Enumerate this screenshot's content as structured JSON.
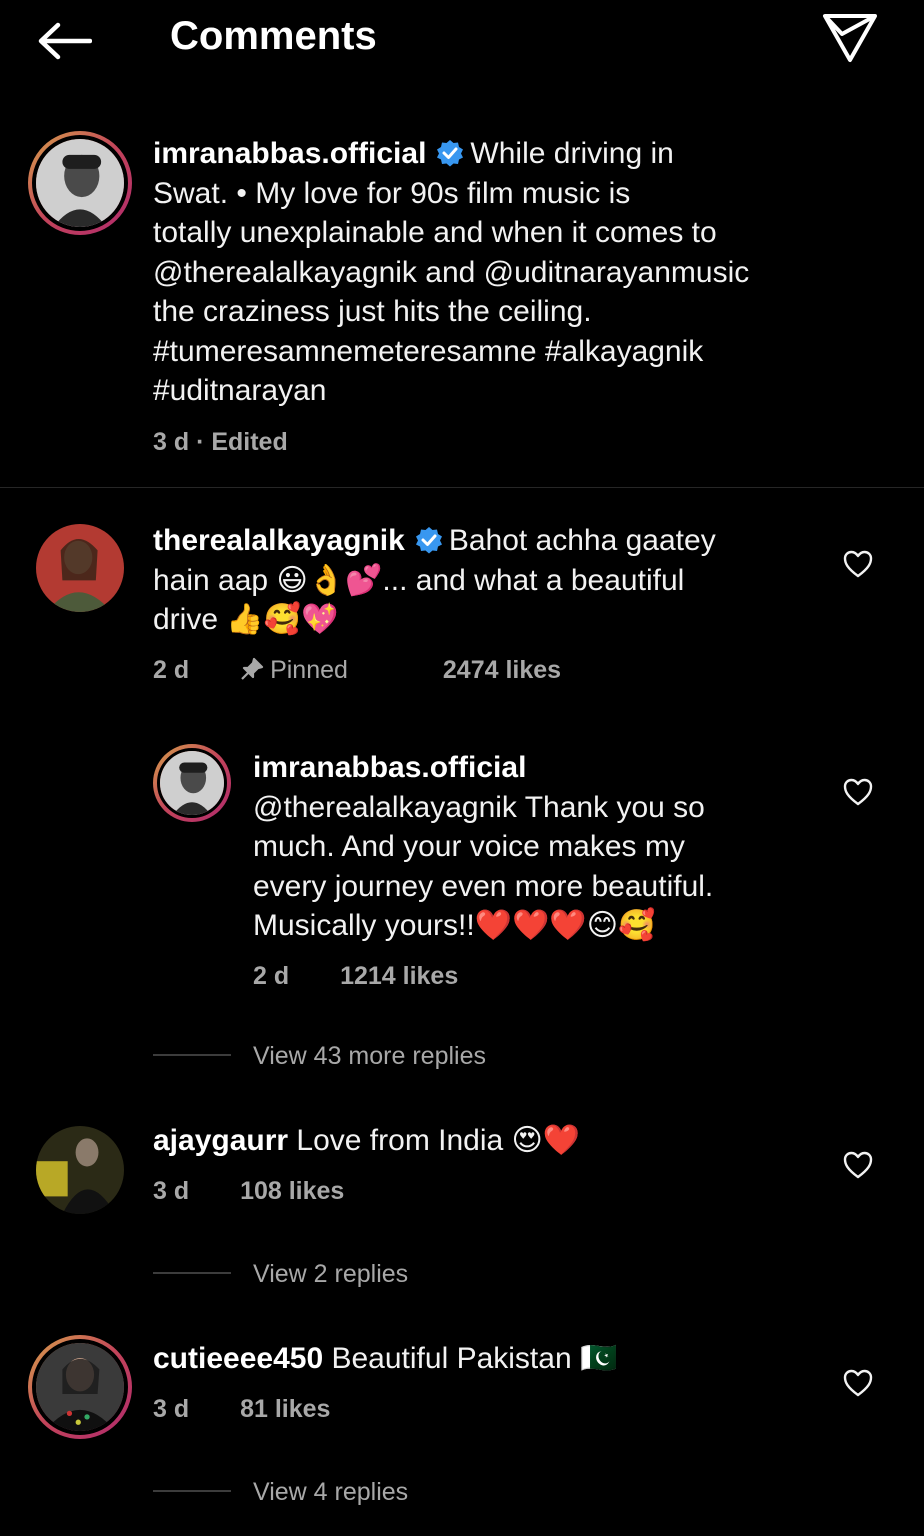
{
  "header": {
    "title": "Comments"
  },
  "caption": {
    "username": "imranabbas.official",
    "text": "While driving in Swat. • My love for 90s film music is totally unexplainable and when it comes to @therealalkayagnik and @uditnarayanmusic the craziness just hits the ceiling. #tumeresamnemeteresamne #alkayagnik #uditnarayan",
    "lines": [
      "Swat. • My love for 90s film music is",
      "totally unexplainable and when it comes to",
      "@therealalkayagnik and @uditnarayanmusic",
      "the craziness just hits the ceiling.",
      "#tumeresamnemeteresamne #alkayagnik",
      "#uditnarayan"
    ],
    "first_line": "While driving in",
    "meta": "3 d · Edited"
  },
  "comments": [
    {
      "username": "therealalkayagnik",
      "first_line": "Bahot achha gaatey",
      "line2": "hain aap 😃👌💕... and what a beautiful",
      "line3": "drive 👍🥰💖",
      "time": "2 d",
      "pinned": "Pinned",
      "likes": "2474 likes"
    },
    {
      "username": "imranabbas.official",
      "lines": [
        "@therealalkayagnik Thank you so",
        "much. And your voice makes my",
        "every journey even more beautiful.",
        "Musically yours!!❤️❤️❤️😊🥰"
      ],
      "time": "2 d",
      "likes": "1214 likes",
      "view_replies": "View 43 more replies"
    },
    {
      "username": "ajaygaurr",
      "text": "Love from India 😍❤️",
      "time": "3 d",
      "likes": "108 likes",
      "view_replies": "View 2 replies"
    },
    {
      "username": "cutieeee450",
      "text": "Beautiful Pakistan 🇵🇰",
      "time": "3 d",
      "likes": "81 likes",
      "view_replies": "View 4 replies"
    }
  ],
  "colors": {
    "background": "#000000",
    "secondary_text": "#a8a8a8",
    "verified": "#3897f0"
  },
  "icons": [
    "back-arrow-icon",
    "send-icon",
    "verified-badge-icon",
    "heart-icon",
    "pin-icon"
  ]
}
